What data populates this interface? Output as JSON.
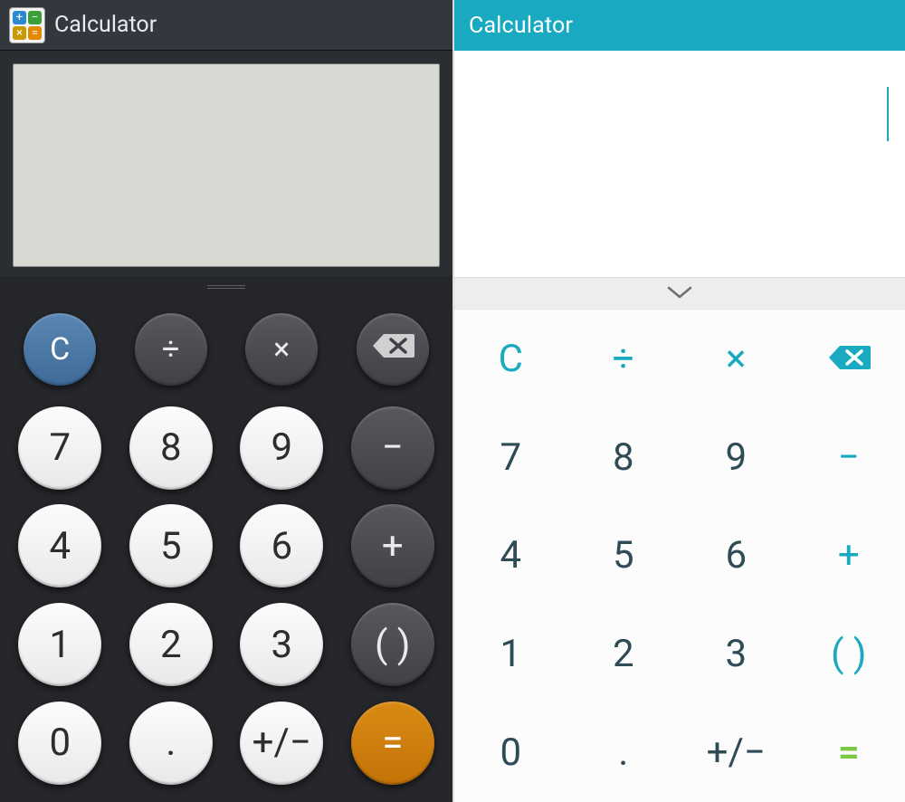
{
  "left": {
    "title": "Calculator",
    "colors": {
      "accent": "#5a86b4",
      "equals": "#d98a12"
    },
    "display_value": "",
    "keys": [
      [
        {
          "id": "clear",
          "label": "C",
          "style": "blue",
          "icon": null
        },
        {
          "id": "divide",
          "label": "÷",
          "style": "dark",
          "icon": null
        },
        {
          "id": "multiply",
          "label": "×",
          "style": "dark",
          "icon": null
        },
        {
          "id": "backspace",
          "label": "",
          "style": "dark",
          "icon": "backspace"
        }
      ],
      [
        {
          "id": "seven",
          "label": "7",
          "style": "white",
          "icon": null
        },
        {
          "id": "eight",
          "label": "8",
          "style": "white",
          "icon": null
        },
        {
          "id": "nine",
          "label": "9",
          "style": "white",
          "icon": null
        },
        {
          "id": "minus",
          "label": "−",
          "style": "dark",
          "icon": null
        }
      ],
      [
        {
          "id": "four",
          "label": "4",
          "style": "white",
          "icon": null
        },
        {
          "id": "five",
          "label": "5",
          "style": "white",
          "icon": null
        },
        {
          "id": "six",
          "label": "6",
          "style": "white",
          "icon": null
        },
        {
          "id": "plus",
          "label": "+",
          "style": "dark",
          "icon": null
        }
      ],
      [
        {
          "id": "one",
          "label": "1",
          "style": "white",
          "icon": null
        },
        {
          "id": "two",
          "label": "2",
          "style": "white",
          "icon": null
        },
        {
          "id": "three",
          "label": "3",
          "style": "white",
          "icon": null
        },
        {
          "id": "parens",
          "label": "( )",
          "style": "dark",
          "icon": null
        }
      ],
      [
        {
          "id": "zero",
          "label": "0",
          "style": "white",
          "icon": null
        },
        {
          "id": "decimal",
          "label": ".",
          "style": "white",
          "icon": null
        },
        {
          "id": "sign",
          "label": "+/−",
          "style": "white",
          "icon": null
        },
        {
          "id": "equals",
          "label": "=",
          "style": "orange",
          "icon": null
        }
      ]
    ]
  },
  "right": {
    "title": "Calculator",
    "colors": {
      "accent": "#19a9c0",
      "equals": "#7ac943"
    },
    "display_value": "",
    "keys": [
      [
        {
          "id": "clear",
          "label": "C",
          "klass": "accent",
          "icon": null
        },
        {
          "id": "divide",
          "label": "÷",
          "klass": "accent",
          "icon": null
        },
        {
          "id": "multiply",
          "label": "×",
          "klass": "accent",
          "icon": null
        },
        {
          "id": "backspace",
          "label": "",
          "klass": "accent",
          "icon": "backspace"
        }
      ],
      [
        {
          "id": "seven",
          "label": "7",
          "klass": "",
          "icon": null
        },
        {
          "id": "eight",
          "label": "8",
          "klass": "",
          "icon": null
        },
        {
          "id": "nine",
          "label": "9",
          "klass": "",
          "icon": null
        },
        {
          "id": "minus",
          "label": "−",
          "klass": "accent",
          "icon": null
        }
      ],
      [
        {
          "id": "four",
          "label": "4",
          "klass": "",
          "icon": null
        },
        {
          "id": "five",
          "label": "5",
          "klass": "",
          "icon": null
        },
        {
          "id": "six",
          "label": "6",
          "klass": "",
          "icon": null
        },
        {
          "id": "plus",
          "label": "+",
          "klass": "accent",
          "icon": null
        }
      ],
      [
        {
          "id": "one",
          "label": "1",
          "klass": "",
          "icon": null
        },
        {
          "id": "two",
          "label": "2",
          "klass": "",
          "icon": null
        },
        {
          "id": "three",
          "label": "3",
          "klass": "",
          "icon": null
        },
        {
          "id": "parens",
          "label": "( )",
          "klass": "accent",
          "icon": null
        }
      ],
      [
        {
          "id": "zero",
          "label": "0",
          "klass": "",
          "icon": null
        },
        {
          "id": "decimal",
          "label": ".",
          "klass": "",
          "icon": null
        },
        {
          "id": "sign",
          "label": "+/−",
          "klass": "",
          "icon": null
        },
        {
          "id": "equals",
          "label": "=",
          "klass": "equals",
          "icon": null
        }
      ]
    ]
  }
}
